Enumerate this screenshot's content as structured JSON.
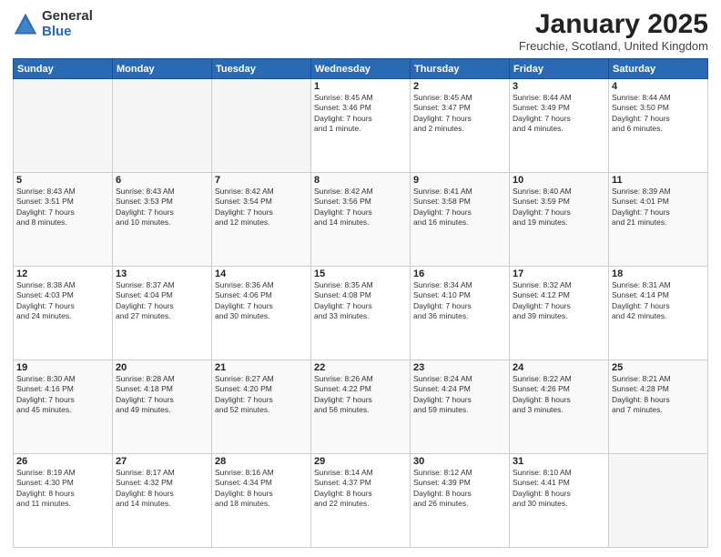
{
  "logo": {
    "general": "General",
    "blue": "Blue"
  },
  "header": {
    "month": "January 2025",
    "location": "Freuchie, Scotland, United Kingdom"
  },
  "days_of_week": [
    "Sunday",
    "Monday",
    "Tuesday",
    "Wednesday",
    "Thursday",
    "Friday",
    "Saturday"
  ],
  "weeks": [
    [
      {
        "day": "",
        "info": ""
      },
      {
        "day": "",
        "info": ""
      },
      {
        "day": "",
        "info": ""
      },
      {
        "day": "1",
        "info": "Sunrise: 8:45 AM\nSunset: 3:46 PM\nDaylight: 7 hours\nand 1 minute."
      },
      {
        "day": "2",
        "info": "Sunrise: 8:45 AM\nSunset: 3:47 PM\nDaylight: 7 hours\nand 2 minutes."
      },
      {
        "day": "3",
        "info": "Sunrise: 8:44 AM\nSunset: 3:49 PM\nDaylight: 7 hours\nand 4 minutes."
      },
      {
        "day": "4",
        "info": "Sunrise: 8:44 AM\nSunset: 3:50 PM\nDaylight: 7 hours\nand 6 minutes."
      }
    ],
    [
      {
        "day": "5",
        "info": "Sunrise: 8:43 AM\nSunset: 3:51 PM\nDaylight: 7 hours\nand 8 minutes."
      },
      {
        "day": "6",
        "info": "Sunrise: 8:43 AM\nSunset: 3:53 PM\nDaylight: 7 hours\nand 10 minutes."
      },
      {
        "day": "7",
        "info": "Sunrise: 8:42 AM\nSunset: 3:54 PM\nDaylight: 7 hours\nand 12 minutes."
      },
      {
        "day": "8",
        "info": "Sunrise: 8:42 AM\nSunset: 3:56 PM\nDaylight: 7 hours\nand 14 minutes."
      },
      {
        "day": "9",
        "info": "Sunrise: 8:41 AM\nSunset: 3:58 PM\nDaylight: 7 hours\nand 16 minutes."
      },
      {
        "day": "10",
        "info": "Sunrise: 8:40 AM\nSunset: 3:59 PM\nDaylight: 7 hours\nand 19 minutes."
      },
      {
        "day": "11",
        "info": "Sunrise: 8:39 AM\nSunset: 4:01 PM\nDaylight: 7 hours\nand 21 minutes."
      }
    ],
    [
      {
        "day": "12",
        "info": "Sunrise: 8:38 AM\nSunset: 4:03 PM\nDaylight: 7 hours\nand 24 minutes."
      },
      {
        "day": "13",
        "info": "Sunrise: 8:37 AM\nSunset: 4:04 PM\nDaylight: 7 hours\nand 27 minutes."
      },
      {
        "day": "14",
        "info": "Sunrise: 8:36 AM\nSunset: 4:06 PM\nDaylight: 7 hours\nand 30 minutes."
      },
      {
        "day": "15",
        "info": "Sunrise: 8:35 AM\nSunset: 4:08 PM\nDaylight: 7 hours\nand 33 minutes."
      },
      {
        "day": "16",
        "info": "Sunrise: 8:34 AM\nSunset: 4:10 PM\nDaylight: 7 hours\nand 36 minutes."
      },
      {
        "day": "17",
        "info": "Sunrise: 8:32 AM\nSunset: 4:12 PM\nDaylight: 7 hours\nand 39 minutes."
      },
      {
        "day": "18",
        "info": "Sunrise: 8:31 AM\nSunset: 4:14 PM\nDaylight: 7 hours\nand 42 minutes."
      }
    ],
    [
      {
        "day": "19",
        "info": "Sunrise: 8:30 AM\nSunset: 4:16 PM\nDaylight: 7 hours\nand 45 minutes."
      },
      {
        "day": "20",
        "info": "Sunrise: 8:28 AM\nSunset: 4:18 PM\nDaylight: 7 hours\nand 49 minutes."
      },
      {
        "day": "21",
        "info": "Sunrise: 8:27 AM\nSunset: 4:20 PM\nDaylight: 7 hours\nand 52 minutes."
      },
      {
        "day": "22",
        "info": "Sunrise: 8:26 AM\nSunset: 4:22 PM\nDaylight: 7 hours\nand 56 minutes."
      },
      {
        "day": "23",
        "info": "Sunrise: 8:24 AM\nSunset: 4:24 PM\nDaylight: 7 hours\nand 59 minutes."
      },
      {
        "day": "24",
        "info": "Sunrise: 8:22 AM\nSunset: 4:26 PM\nDaylight: 8 hours\nand 3 minutes."
      },
      {
        "day": "25",
        "info": "Sunrise: 8:21 AM\nSunset: 4:28 PM\nDaylight: 8 hours\nand 7 minutes."
      }
    ],
    [
      {
        "day": "26",
        "info": "Sunrise: 8:19 AM\nSunset: 4:30 PM\nDaylight: 8 hours\nand 11 minutes."
      },
      {
        "day": "27",
        "info": "Sunrise: 8:17 AM\nSunset: 4:32 PM\nDaylight: 8 hours\nand 14 minutes."
      },
      {
        "day": "28",
        "info": "Sunrise: 8:16 AM\nSunset: 4:34 PM\nDaylight: 8 hours\nand 18 minutes."
      },
      {
        "day": "29",
        "info": "Sunrise: 8:14 AM\nSunset: 4:37 PM\nDaylight: 8 hours\nand 22 minutes."
      },
      {
        "day": "30",
        "info": "Sunrise: 8:12 AM\nSunset: 4:39 PM\nDaylight: 8 hours\nand 26 minutes."
      },
      {
        "day": "31",
        "info": "Sunrise: 8:10 AM\nSunset: 4:41 PM\nDaylight: 8 hours\nand 30 minutes."
      },
      {
        "day": "",
        "info": ""
      }
    ]
  ]
}
